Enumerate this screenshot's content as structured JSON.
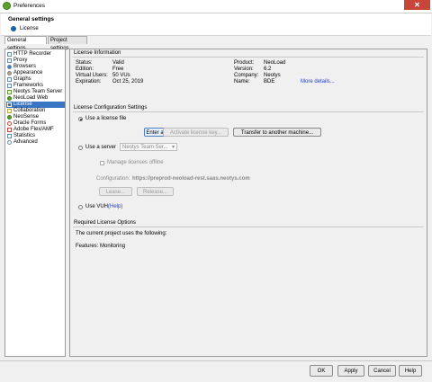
{
  "window": {
    "title": "Preferences",
    "close_glyph": "✕"
  },
  "header": {
    "title": "General settings",
    "subtitle": "License"
  },
  "tabs": [
    {
      "label": "General settings"
    },
    {
      "label": "Project settings"
    }
  ],
  "tree": {
    "items": [
      {
        "label": "HTTP Recorder"
      },
      {
        "label": "Proxy"
      },
      {
        "label": "Browsers"
      },
      {
        "label": "Appearance"
      },
      {
        "label": "Graphs"
      },
      {
        "label": "Frameworks"
      },
      {
        "label": "Neotys Team Server"
      },
      {
        "label": "NeoLoad Web"
      },
      {
        "label": "License"
      },
      {
        "label": "Collaboration"
      },
      {
        "label": "NeoSense"
      },
      {
        "label": "Oracle Forms"
      },
      {
        "label": "Adobe Flex/AMF"
      },
      {
        "label": "Statistics"
      },
      {
        "label": "Advanced"
      }
    ],
    "selected": "License"
  },
  "license_info": {
    "title": "License Information",
    "left": [
      {
        "key": "Status:",
        "value": "Valid"
      },
      {
        "key": "Edition:",
        "value": "Free"
      },
      {
        "key": "Virtual Users:",
        "value": "50 VUs"
      },
      {
        "key": "Expiration:",
        "value": "Oct 25, 2019"
      }
    ],
    "right": [
      {
        "key": "Product:",
        "value": "NeoLoad"
      },
      {
        "key": "Version:",
        "value": "6.2"
      },
      {
        "key": "Company:",
        "value": "Neotys"
      },
      {
        "key": "Name:",
        "value": "BDE"
      }
    ],
    "more_details": "More details..."
  },
  "config": {
    "title": "License Configuration Settings",
    "use_license_file": "Use a license file",
    "enter_key": "Enter a license key...",
    "activate_key": "Activate license key...",
    "transfer": "Transfer to another machine...",
    "use_server": "Use a server",
    "server_combo": "Neotys Team Ser...",
    "manage_offline": "Manage licenses offline",
    "configuration_label": "Configuration:",
    "configuration_url": "https://preprod-neoload-rest.saas.neotys.com",
    "lease": "Lease...",
    "release": "Release...",
    "use_vuh": "Use VUH",
    "help_link": "(Help)"
  },
  "required": {
    "title": "Required License Options",
    "line1": "The current project uses the following:",
    "line2": "Features: Monitoring"
  },
  "buttons": {
    "ok": "OK",
    "apply": "Apply",
    "cancel": "Cancel",
    "help": "Help"
  },
  "colors": {
    "selection": "#3876c4",
    "link": "#1f3cd1",
    "close": "#c8453a"
  }
}
